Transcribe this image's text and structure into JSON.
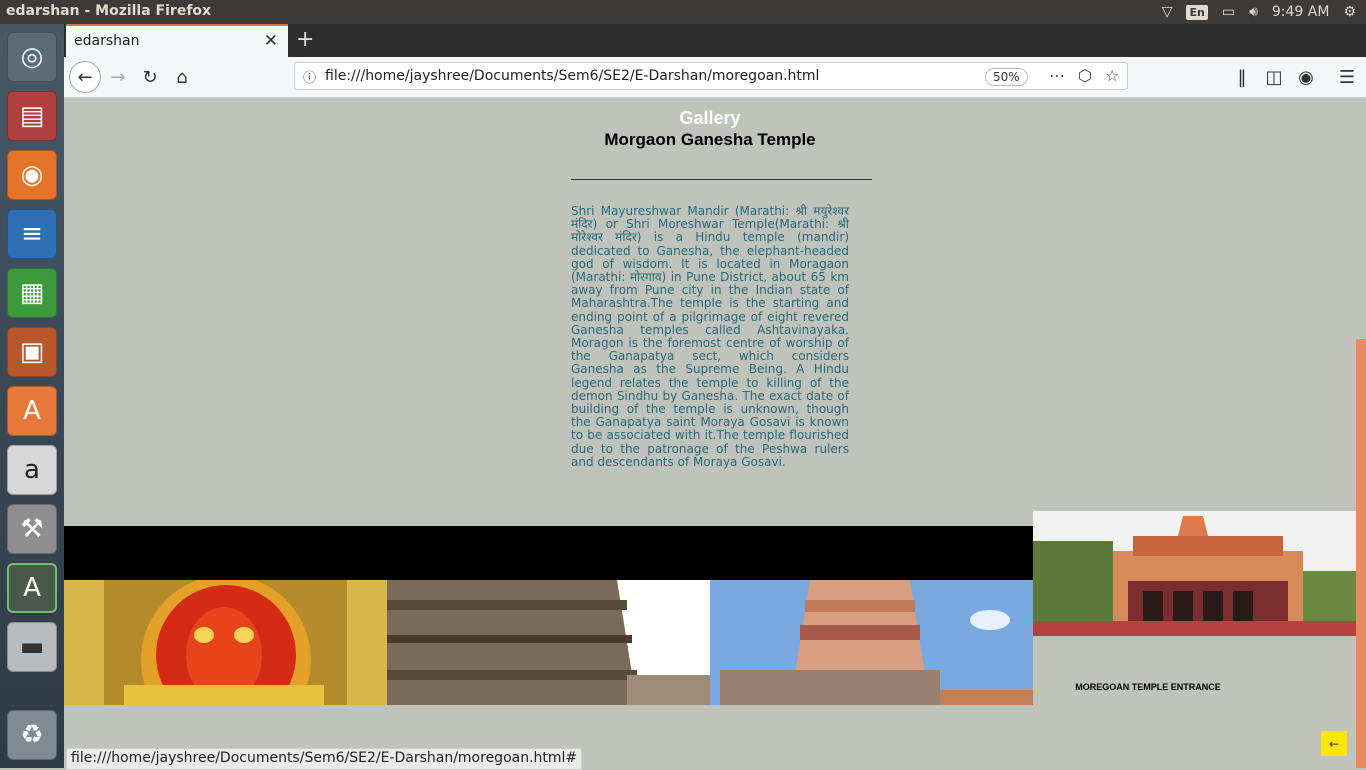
{
  "system": {
    "window_title": "edarshan - Mozilla Firefox",
    "keyboard_layout": "En",
    "time": "9:49 AM"
  },
  "launcher": {
    "items": [
      "ubuntu-dash-icon",
      "files-icon",
      "firefox-icon",
      "writer-icon",
      "calc-icon",
      "impress-icon",
      "software-center-icon",
      "amazon-icon",
      "system-settings-icon",
      "software-updater-icon",
      "drive-icon",
      "trash-icon"
    ]
  },
  "browser": {
    "tab_title": "edarshan",
    "url": "file:///home/jayshree/Documents/Sem6/SE2/E-Darshan/moregoan.html",
    "zoom": "50%",
    "status_url": "file:///home/jayshree/Documents/Sem6/SE2/E-Darshan/moregoan.html#"
  },
  "page": {
    "title": "Morgaon Ganesha Temple",
    "description": "Shri Mayureshwar Mandir (Marathi: श्री मयुरेश्वर मंदिर) or Shri Moreshwar Temple(Marathi: श्री मोरेश्वर मंदिर) is a Hindu temple (mandir) dedicated to Ganesha, the elephant-headed god of wisdom. It is located in Moragaon (Marathi: मोरगाव) in Pune District, about 65 km away from Pune city in the Indian state of Maharashtra.The temple is the starting and ending point of a pilgrimage of eight revered Ganesha temples called Ashtavinayaka. Moragon is the foremost centre of worship of the Ganapatya sect, which considers Ganesha as the Supreme Being. A Hindu legend relates the temple to killing of the demon Sindhu by Ganesha. The exact date of building of the temple is unknown, though the Ganapatya saint Moraya Gosavi is known to be associated with it.The temple flourished due to the patronage of the Peshwa rulers and descendants of Moraya Gosavi.",
    "gallery_title": "Gallery",
    "entrance_caption": "MOREGOAN TEMPLE ENTRANCE"
  },
  "colors": {
    "page_bg": "#c0c2bc",
    "text_teal": "#2a6a7a",
    "gallery_bar": "#000000",
    "scroll_accent": "#e98a60",
    "back_to_top": "#ffe600"
  }
}
